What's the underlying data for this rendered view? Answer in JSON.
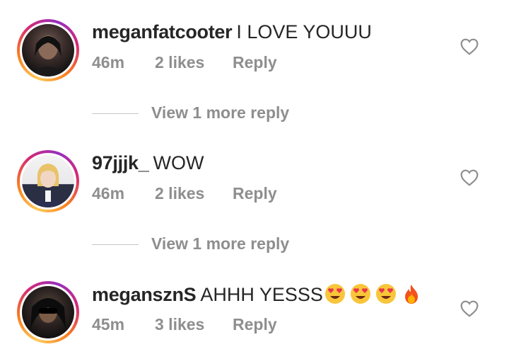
{
  "comments": [
    {
      "username": "meganfatcooter",
      "text": "I LOVE YOUUU",
      "time": "46m",
      "likes": "2 likes",
      "reply": "Reply"
    },
    {
      "username": "97jjjk_",
      "text": "WOW",
      "time": "46m",
      "likes": "2 likes",
      "reply": "Reply"
    },
    {
      "username": "megansznS",
      "text": "AHHH YESSS",
      "time": "45m",
      "likes": "3 likes",
      "reply": "Reply",
      "emojis": [
        "heart-eyes-emoji",
        "heart-eyes-emoji",
        "heart-eyes-emoji",
        "fire-emoji"
      ]
    }
  ],
  "view_more_replies": [
    "View 1 more reply",
    "View 1 more reply"
  ],
  "colors": {
    "text": "#262626",
    "muted": "#8e8e8e",
    "divider": "#c7c7c7"
  }
}
